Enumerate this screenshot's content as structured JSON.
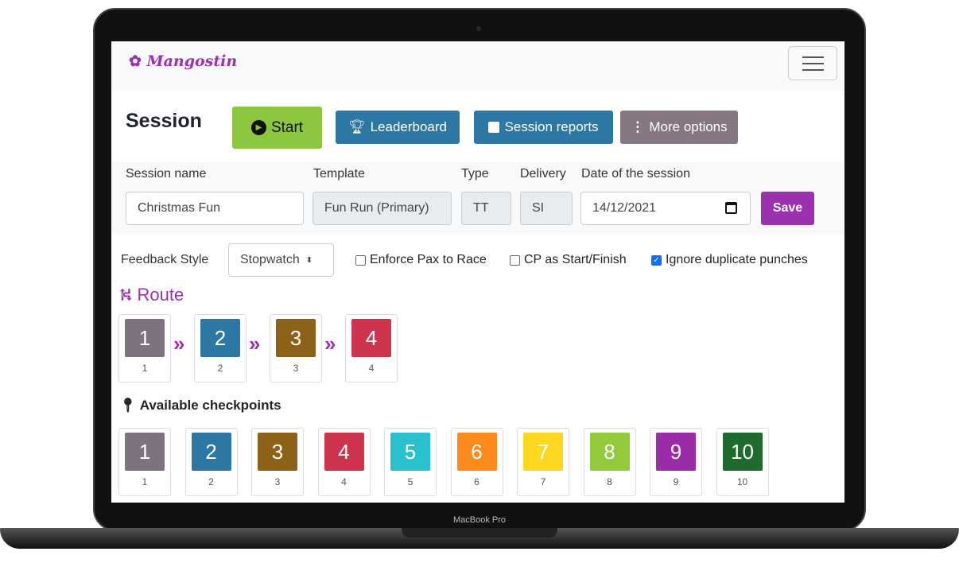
{
  "device_label": "MacBook Pro",
  "brand": "Mangostin",
  "title": "Session",
  "buttons": {
    "start": "Start",
    "leaderboard": "Leaderboard",
    "reports": "Session reports",
    "more": "More options",
    "save": "Save"
  },
  "fields": {
    "session_name": {
      "label": "Session name",
      "value": "Christmas Fun"
    },
    "template": {
      "label": "Template",
      "value": "Fun Run (Primary)"
    },
    "type": {
      "label": "Type",
      "value": "TT"
    },
    "delivery": {
      "label": "Delivery",
      "value": "SI"
    },
    "date": {
      "label": "Date of the session",
      "value": "14/12/2021"
    }
  },
  "feedback": {
    "label": "Feedback Style",
    "value": "Stopwatch"
  },
  "options": [
    {
      "label": "Enforce Pax to Race",
      "checked": false
    },
    {
      "label": "CP as Start/Finish",
      "checked": false
    },
    {
      "label": "Ignore duplicate punches",
      "checked": true
    }
  ],
  "route_title": "Route",
  "route": [
    {
      "num": "1",
      "label": "1",
      "color": "#7d727e"
    },
    {
      "num": "2",
      "label": "2",
      "color": "#2c77a3"
    },
    {
      "num": "3",
      "label": "3",
      "color": "#8c6218"
    },
    {
      "num": "4",
      "label": "4",
      "color": "#cf344f"
    }
  ],
  "available_title": "Available checkpoints",
  "checkpoints": [
    {
      "num": "1",
      "label": "1",
      "color": "#7d727e"
    },
    {
      "num": "2",
      "label": "2",
      "color": "#2c77a3"
    },
    {
      "num": "3",
      "label": "3",
      "color": "#8c6218"
    },
    {
      "num": "4",
      "label": "4",
      "color": "#cf344f"
    },
    {
      "num": "5",
      "label": "5",
      "color": "#29c2cc"
    },
    {
      "num": "6",
      "label": "6",
      "color": "#fb8a1b"
    },
    {
      "num": "7",
      "label": "7",
      "color": "#fbd81f"
    },
    {
      "num": "8",
      "label": "8",
      "color": "#93c93a"
    },
    {
      "num": "9",
      "label": "9",
      "color": "#9a2ca8"
    },
    {
      "num": "10",
      "label": "10",
      "color": "#1f6a2e"
    }
  ]
}
